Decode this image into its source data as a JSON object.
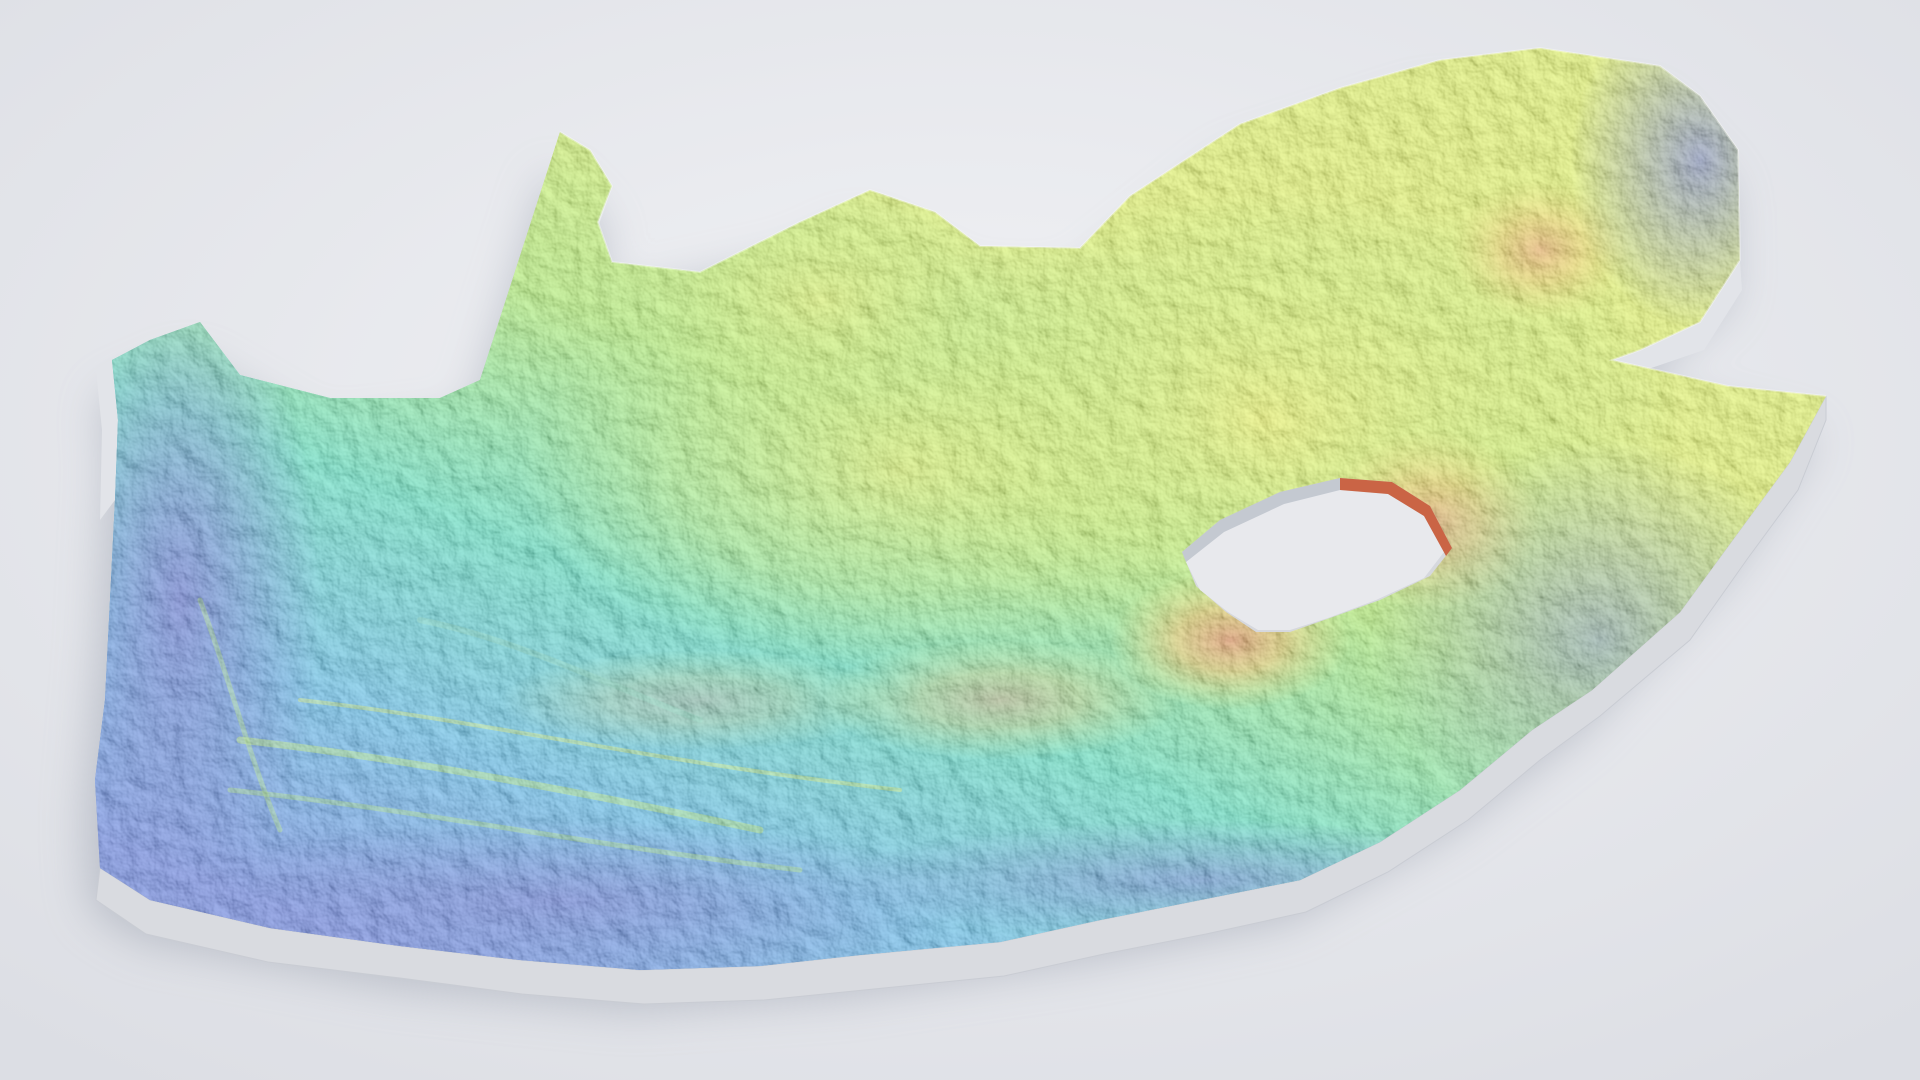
{
  "map": {
    "type": "3d-elevation-relief",
    "region_shape": "south-africa-outline",
    "enclave_shape": "lesotho-hole",
    "background_color": "#e9eaee",
    "wall_color": "#e6e7ea",
    "colormap": {
      "low": "#2233b8",
      "mid_low": "#1f8ee8",
      "mid": "#1fd3a8",
      "mid_high": "#c6f02a",
      "high": "#f0b018",
      "peak": "#d8401a"
    },
    "labels": []
  }
}
